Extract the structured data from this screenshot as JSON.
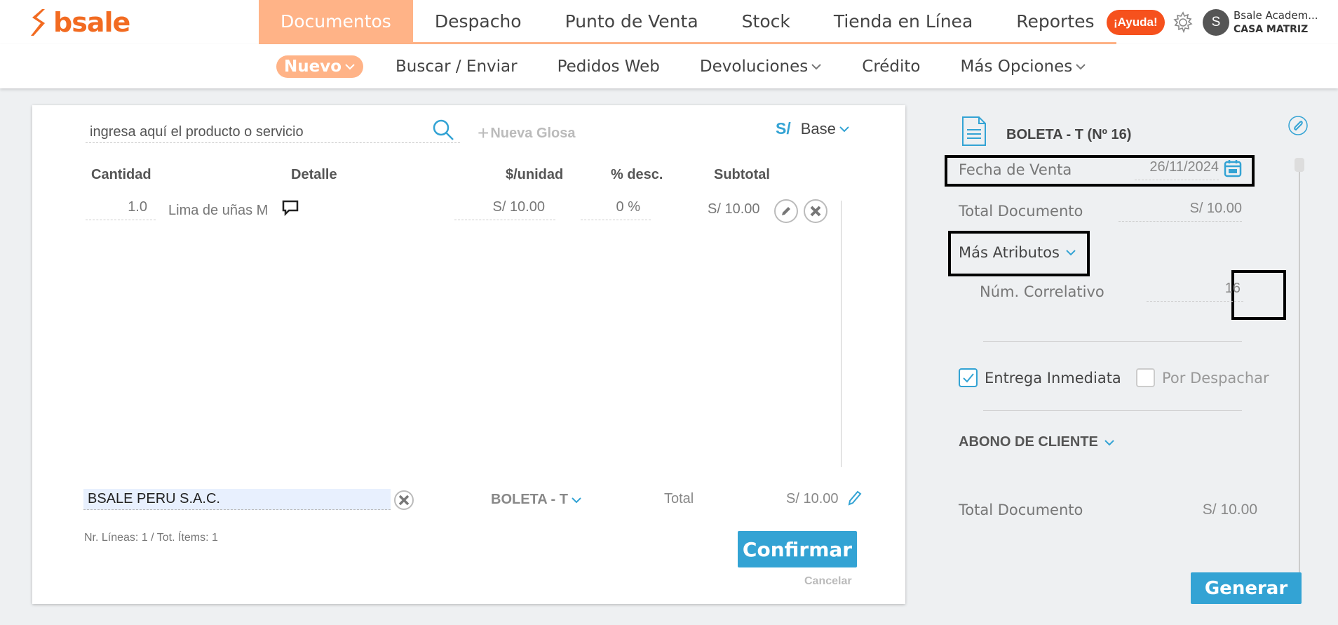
{
  "brand": {
    "logo_text": "bsale",
    "color": "#f26b21"
  },
  "main_nav": [
    {
      "label": "Documentos",
      "active": true
    },
    {
      "label": "Despacho"
    },
    {
      "label": "Punto de Venta"
    },
    {
      "label": "Stock"
    },
    {
      "label": "Tienda en Línea"
    },
    {
      "label": "Reportes"
    }
  ],
  "header": {
    "help_label": "¡Ayuda!",
    "avatar_initial": "S",
    "user_name": "Bsale Academ...",
    "branch": "CASA MATRIZ"
  },
  "sub_nav": [
    {
      "label": "Nuevo",
      "active": true,
      "dropdown": true
    },
    {
      "label": "Buscar / Enviar"
    },
    {
      "label": "Pedidos Web"
    },
    {
      "label": "Devoluciones",
      "dropdown": true
    },
    {
      "label": "Crédito"
    },
    {
      "label": "Más Opciones",
      "dropdown": true
    }
  ],
  "editor": {
    "search_value": "ingresa aquí el producto o servicio",
    "nueva_glosa": "Nueva Glosa",
    "currency_symbol": "S/",
    "price_list": "Base",
    "columns": {
      "cantidad": "Cantidad",
      "detalle": "Detalle",
      "unidad": "$/unidad",
      "desc": "% desc.",
      "subtotal": "Subtotal"
    },
    "rows": [
      {
        "cantidad": "1.0",
        "detalle": "Lima de uñas M",
        "unidad": "S/ 10.00",
        "desc": "0 %",
        "subtotal": "S/ 10.00"
      }
    ],
    "client": "BSALE PERU S.A.C.",
    "doc_type": "BOLETA - T",
    "total_label": "Total",
    "total_value": "S/ 10.00",
    "lines_info": "Nr. Líneas: 1 / Tot. Ítems: 1",
    "confirm": "Confirmar",
    "cancel": "Cancelar"
  },
  "side": {
    "doc_title": "BOLETA - T (Nº 16)",
    "fecha_label": "Fecha de Venta",
    "fecha_value": "26/11/2024",
    "total_doc_label": "Total Documento",
    "total_doc_value": "S/ 10.00",
    "mas_atributos": "Más Atributos",
    "correlativo_label": "Núm. Correlativo",
    "correlativo_value": "16",
    "entrega_inmediata": "Entrega Inmediata",
    "entrega_checked": true,
    "por_despachar": "Por Despachar",
    "despachar_checked": false,
    "abono": "ABONO DE CLIENTE",
    "total_doc_label_2": "Total Documento",
    "total_doc_value_2": "S/ 10.00",
    "generar": "Generar"
  },
  "colors": {
    "accent": "#33a3d4",
    "nav_active": "#ffb387",
    "help": "#f6511d"
  }
}
